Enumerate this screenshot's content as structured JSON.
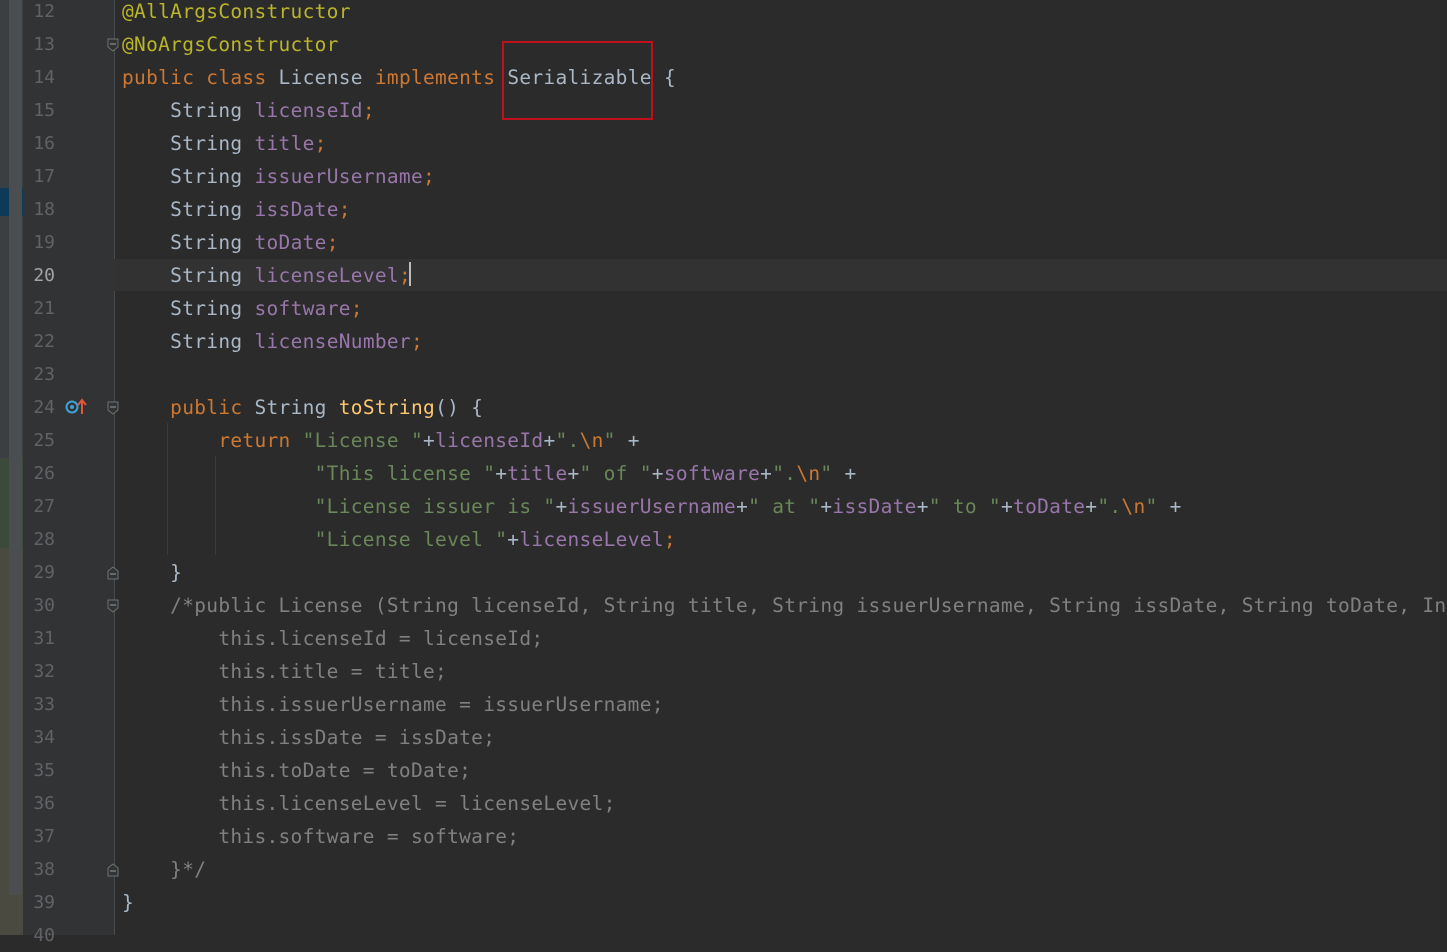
{
  "editor": {
    "current_line": 20,
    "lines": [
      {
        "n": "12",
        "tokens": [
          {
            "t": "@AllArgsConstructor",
            "c": "ann"
          }
        ]
      },
      {
        "n": "13",
        "tokens": [
          {
            "t": "@NoArgsConstructor",
            "c": "ann"
          }
        ]
      },
      {
        "n": "14",
        "tokens": [
          {
            "t": "public class ",
            "c": "kw"
          },
          {
            "t": "License ",
            "c": "plain"
          },
          {
            "t": "implements ",
            "c": "kw"
          },
          {
            "t": "Serializable ",
            "c": "plain"
          },
          {
            "t": "{",
            "c": "plain"
          }
        ]
      },
      {
        "n": "15",
        "tokens": [
          {
            "t": "    String ",
            "c": "plain"
          },
          {
            "t": "licenseId",
            "c": "fld"
          },
          {
            "t": ";",
            "c": "kw"
          }
        ]
      },
      {
        "n": "16",
        "tokens": [
          {
            "t": "    String ",
            "c": "plain"
          },
          {
            "t": "title",
            "c": "fld"
          },
          {
            "t": ";",
            "c": "kw"
          }
        ]
      },
      {
        "n": "17",
        "tokens": [
          {
            "t": "    String ",
            "c": "plain"
          },
          {
            "t": "issuerUsername",
            "c": "fld"
          },
          {
            "t": ";",
            "c": "kw"
          }
        ]
      },
      {
        "n": "18",
        "tokens": [
          {
            "t": "    String ",
            "c": "plain"
          },
          {
            "t": "issDate",
            "c": "fld"
          },
          {
            "t": ";",
            "c": "kw"
          }
        ]
      },
      {
        "n": "19",
        "tokens": [
          {
            "t": "    String ",
            "c": "plain"
          },
          {
            "t": "toDate",
            "c": "fld"
          },
          {
            "t": ";",
            "c": "kw"
          }
        ]
      },
      {
        "n": "20",
        "tokens": [
          {
            "t": "    String ",
            "c": "plain"
          },
          {
            "t": "licenseLevel",
            "c": "fld"
          },
          {
            "t": ";",
            "c": "kw"
          }
        ]
      },
      {
        "n": "21",
        "tokens": [
          {
            "t": "    String ",
            "c": "plain"
          },
          {
            "t": "software",
            "c": "fld"
          },
          {
            "t": ";",
            "c": "kw"
          }
        ]
      },
      {
        "n": "22",
        "tokens": [
          {
            "t": "    String ",
            "c": "plain"
          },
          {
            "t": "licenseNumber",
            "c": "fld"
          },
          {
            "t": ";",
            "c": "kw"
          }
        ]
      },
      {
        "n": "23",
        "tokens": []
      },
      {
        "n": "24",
        "tokens": [
          {
            "t": "    public ",
            "c": "kw"
          },
          {
            "t": "String ",
            "c": "plain"
          },
          {
            "t": "toString",
            "c": "fn"
          },
          {
            "t": "() {",
            "c": "plain"
          }
        ]
      },
      {
        "n": "25",
        "tokens": [
          {
            "t": "        return ",
            "c": "kw"
          },
          {
            "t": "\"License \"",
            "c": "str"
          },
          {
            "t": "+",
            "c": "plain"
          },
          {
            "t": "licenseId",
            "c": "fld"
          },
          {
            "t": "+",
            "c": "plain"
          },
          {
            "t": "\".",
            "c": "str"
          },
          {
            "t": "\\n",
            "c": "esc"
          },
          {
            "t": "\" ",
            "c": "str"
          },
          {
            "t": "+",
            "c": "plain"
          }
        ]
      },
      {
        "n": "26",
        "tokens": [
          {
            "t": "                ",
            "c": "plain"
          },
          {
            "t": "\"This license \"",
            "c": "str"
          },
          {
            "t": "+",
            "c": "plain"
          },
          {
            "t": "title",
            "c": "fld"
          },
          {
            "t": "+",
            "c": "plain"
          },
          {
            "t": "\" of \"",
            "c": "str"
          },
          {
            "t": "+",
            "c": "plain"
          },
          {
            "t": "software",
            "c": "fld"
          },
          {
            "t": "+",
            "c": "plain"
          },
          {
            "t": "\".",
            "c": "str"
          },
          {
            "t": "\\n",
            "c": "esc"
          },
          {
            "t": "\" ",
            "c": "str"
          },
          {
            "t": "+",
            "c": "plain"
          }
        ]
      },
      {
        "n": "27",
        "tokens": [
          {
            "t": "                ",
            "c": "plain"
          },
          {
            "t": "\"License issuer is \"",
            "c": "str"
          },
          {
            "t": "+",
            "c": "plain"
          },
          {
            "t": "issuerUsername",
            "c": "fld"
          },
          {
            "t": "+",
            "c": "plain"
          },
          {
            "t": "\" at \"",
            "c": "str"
          },
          {
            "t": "+",
            "c": "plain"
          },
          {
            "t": "issDate",
            "c": "fld"
          },
          {
            "t": "+",
            "c": "plain"
          },
          {
            "t": "\" to \"",
            "c": "str"
          },
          {
            "t": "+",
            "c": "plain"
          },
          {
            "t": "toDate",
            "c": "fld"
          },
          {
            "t": "+",
            "c": "plain"
          },
          {
            "t": "\".",
            "c": "str"
          },
          {
            "t": "\\n",
            "c": "esc"
          },
          {
            "t": "\" ",
            "c": "str"
          },
          {
            "t": "+",
            "c": "plain"
          }
        ]
      },
      {
        "n": "28",
        "tokens": [
          {
            "t": "                ",
            "c": "plain"
          },
          {
            "t": "\"License level \"",
            "c": "str"
          },
          {
            "t": "+",
            "c": "plain"
          },
          {
            "t": "licenseLevel",
            "c": "fld"
          },
          {
            "t": ";",
            "c": "kw"
          }
        ]
      },
      {
        "n": "29",
        "tokens": [
          {
            "t": "    }",
            "c": "plain"
          }
        ]
      },
      {
        "n": "30",
        "tokens": [
          {
            "t": "    /*public License (String licenseId, String title, String issuerUsername, String issDate, String toDate, Int",
            "c": "cmt"
          }
        ]
      },
      {
        "n": "31",
        "tokens": [
          {
            "t": "        this.licenseId = licenseId;",
            "c": "cmt"
          }
        ]
      },
      {
        "n": "32",
        "tokens": [
          {
            "t": "        this.title = title;",
            "c": "cmt"
          }
        ]
      },
      {
        "n": "33",
        "tokens": [
          {
            "t": "        this.issuerUsername = issuerUsername;",
            "c": "cmt"
          }
        ]
      },
      {
        "n": "34",
        "tokens": [
          {
            "t": "        this.issDate = issDate;",
            "c": "cmt"
          }
        ]
      },
      {
        "n": "35",
        "tokens": [
          {
            "t": "        this.toDate = toDate;",
            "c": "cmt"
          }
        ]
      },
      {
        "n": "36",
        "tokens": [
          {
            "t": "        this.licenseLevel = licenseLevel;",
            "c": "cmt"
          }
        ]
      },
      {
        "n": "37",
        "tokens": [
          {
            "t": "        this.software = software;",
            "c": "cmt"
          }
        ]
      },
      {
        "n": "38",
        "tokens": [
          {
            "t": "    }*/",
            "c": "cmt"
          }
        ]
      },
      {
        "n": "39",
        "tokens": [
          {
            "t": "}",
            "c": "plain"
          }
        ]
      },
      {
        "n": "40",
        "tokens": []
      }
    ],
    "colors": {
      "background": "#2b2b2b",
      "keyword": "#cc7832",
      "annotation": "#bbb529",
      "field": "#9876aa",
      "string": "#6a8759",
      "method": "#ffc66d",
      "comment": "#808080",
      "highlight_box": "#c0101c"
    },
    "gutter_icons": {
      "line_24": "implements-override-icon"
    }
  }
}
